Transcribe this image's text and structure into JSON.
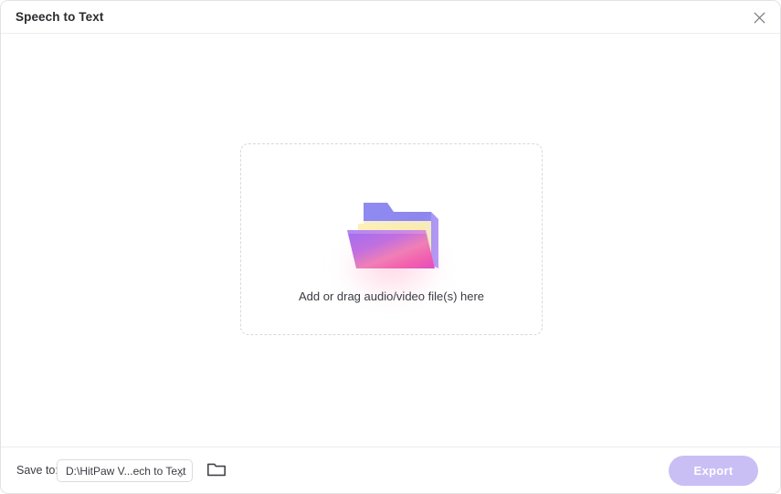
{
  "window": {
    "title": "Speech to Text",
    "close_icon": "close-icon"
  },
  "dropzone": {
    "hint": "Add or drag audio/video file(s) here",
    "icon": "folder-upload-icon"
  },
  "footer": {
    "save_to_label": "Save to:",
    "path_value": "D:\\HitPaw V...ech to Text",
    "path_chevron_icon": "chevron-down-icon",
    "browse_icon": "folder-icon",
    "export_label": "Export"
  },
  "colors": {
    "accent_disabled": "#c9bff5",
    "border": "#e2e2e4",
    "dashed_border": "#d9d9dd",
    "text_primary": "#2b2b2f",
    "text_secondary": "#3b3b42"
  }
}
